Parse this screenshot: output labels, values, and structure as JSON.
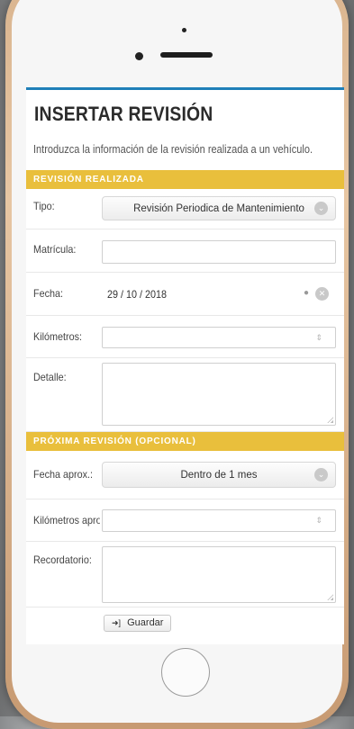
{
  "page": {
    "title": "INSERTAR REVISIÓN",
    "subtitle": "Introduzca la información de la revisión realizada a un vehículo."
  },
  "section1": {
    "heading": "REVISIÓN REALIZADA",
    "tipo_label": "Tipo:",
    "tipo_value": "Revisión Periodica de Mantenimiento",
    "matricula_label": "Matrícula:",
    "matricula_value": "",
    "fecha_label": "Fecha:",
    "fecha_value": "29 / 10 / 2018",
    "km_label": "Kilómetros:",
    "km_value": "",
    "detalle_label": "Detalle:",
    "detalle_value": ""
  },
  "section2": {
    "heading": "PRÓXIMA REVISIÓN (OPCIONAL)",
    "fecha_aprox_label": "Fecha aprox.:",
    "fecha_aprox_value": "Dentro de 1 mes",
    "km_aprox_label": "Kilómetros aprox.:",
    "km_aprox_value": "",
    "recordatorio_label": "Recordatorio:",
    "recordatorio_value": ""
  },
  "actions": {
    "save_label": "Guardar"
  },
  "colors": {
    "accent_bar": "#1f7fb8",
    "section_bg": "#e9bf3c"
  },
  "icons": {
    "select_arrow": "chevron-down-circle-icon",
    "date_clear": "clear-circle-icon",
    "spinner": "spinner-arrows-icon",
    "save": "save-arrow-icon"
  }
}
